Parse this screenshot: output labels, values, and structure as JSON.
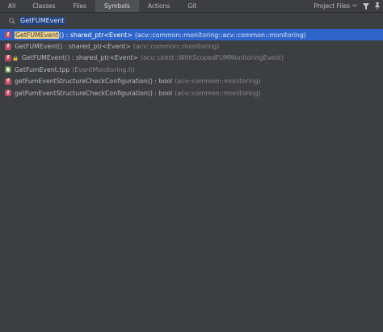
{
  "tabs": [
    {
      "label": "All",
      "active": false
    },
    {
      "label": "Classes",
      "active": false
    },
    {
      "label": "Files",
      "active": false
    },
    {
      "label": "Symbols",
      "active": true
    },
    {
      "label": "Actions",
      "active": false
    },
    {
      "label": "Git",
      "active": false
    }
  ],
  "scope": {
    "label": "Project Files",
    "icon": "chevron-down-icon"
  },
  "toolbar": {
    "filter_icon": "filter-icon",
    "pin_icon": "pin-icon"
  },
  "search": {
    "query": "GetFUMEvent",
    "icon": "search-icon"
  },
  "results": [
    {
      "icon": "function-icon",
      "icon_letter": "f",
      "match": "GetFUMEvent",
      "rest": "() : shared_ptr<Event>",
      "context": "(acv::common::monitoring::acv::common::monitoring)",
      "selected": true
    },
    {
      "icon": "function-icon",
      "icon_letter": "f",
      "match": "",
      "rest": "GetFUMEvent() : shared_ptr<Event>",
      "context": "(acv::common::monitoring)",
      "selected": false
    },
    {
      "icon": "function-icon",
      "icon_letter": "f",
      "match": "",
      "rest": "GetFUMEvent() : shared_ptr<Event>",
      "context": "(acv::utest::WithScopedFUMMonitoringEvent)",
      "selected": false,
      "badge": "lock-icon"
    },
    {
      "icon": "file-icon",
      "icon_letter": "",
      "match": "",
      "rest": "GetFumEvent.tpp",
      "context": "(EventMonitoring.h)",
      "selected": false
    },
    {
      "icon": "function-icon",
      "icon_letter": "f",
      "match": "",
      "rest": "getFumEventStructureCheckConfiguration() : bool",
      "context": "(acv::common::monitoring)",
      "selected": false
    },
    {
      "icon": "function-icon",
      "icon_letter": "f",
      "match": "",
      "rest": "getFumEventStructureCheckConfiguration() : bool",
      "context": "(acv::common::monitoring)",
      "selected": false
    }
  ],
  "colors": {
    "background": "#3c3f41",
    "selection": "#2f65ca",
    "highlight": "#f0d28a",
    "function_icon": "#c04b62",
    "file_icon": "#5f8c48"
  }
}
